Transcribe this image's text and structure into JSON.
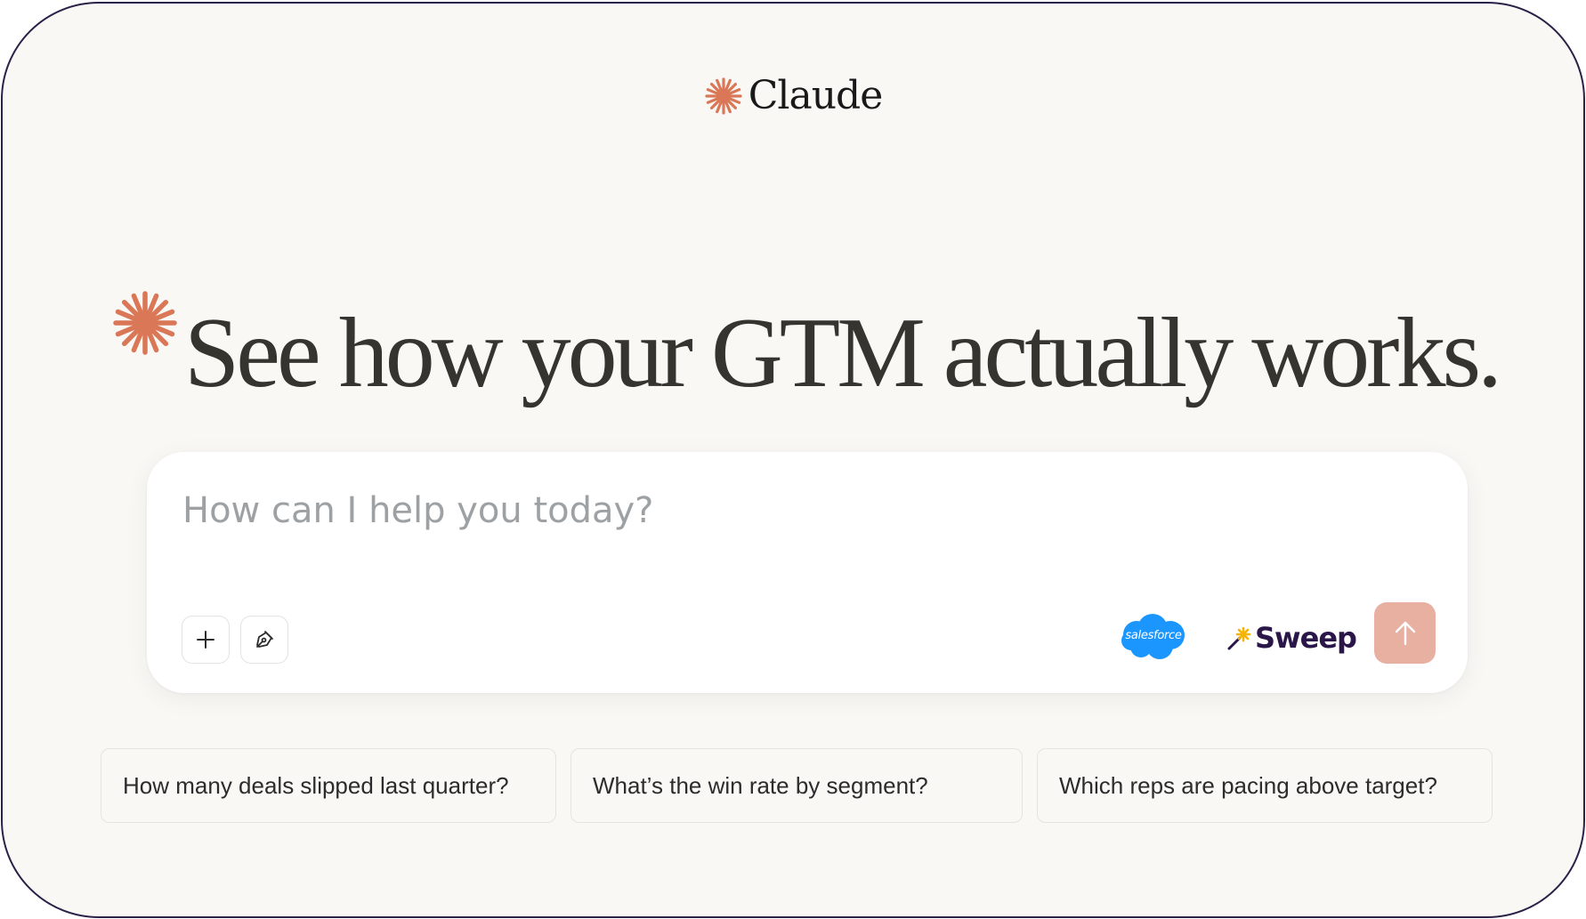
{
  "brand": {
    "name": "Claude",
    "accent_color": "#d97757",
    "icon": "claude-spark-icon"
  },
  "hero": {
    "title": "See how your GTM actually works.",
    "icon": "spark-icon"
  },
  "prompt": {
    "placeholder": "How can I help you today?",
    "value": "",
    "add_icon": "plus-icon",
    "style_icon": "pen-nib-icon",
    "send_icon": "arrow-up-icon",
    "send_color": "#e7b0a1"
  },
  "integrations": {
    "salesforce_label": "salesforce",
    "salesforce_color": "#1b96ff",
    "sweep_label": "Sweep",
    "sweep_color": "#2a1648"
  },
  "suggestions": [
    {
      "label": "How many deals slipped last quarter?"
    },
    {
      "label": "What’s the win rate by segment?"
    },
    {
      "label": "Which reps are pacing above target?"
    }
  ]
}
